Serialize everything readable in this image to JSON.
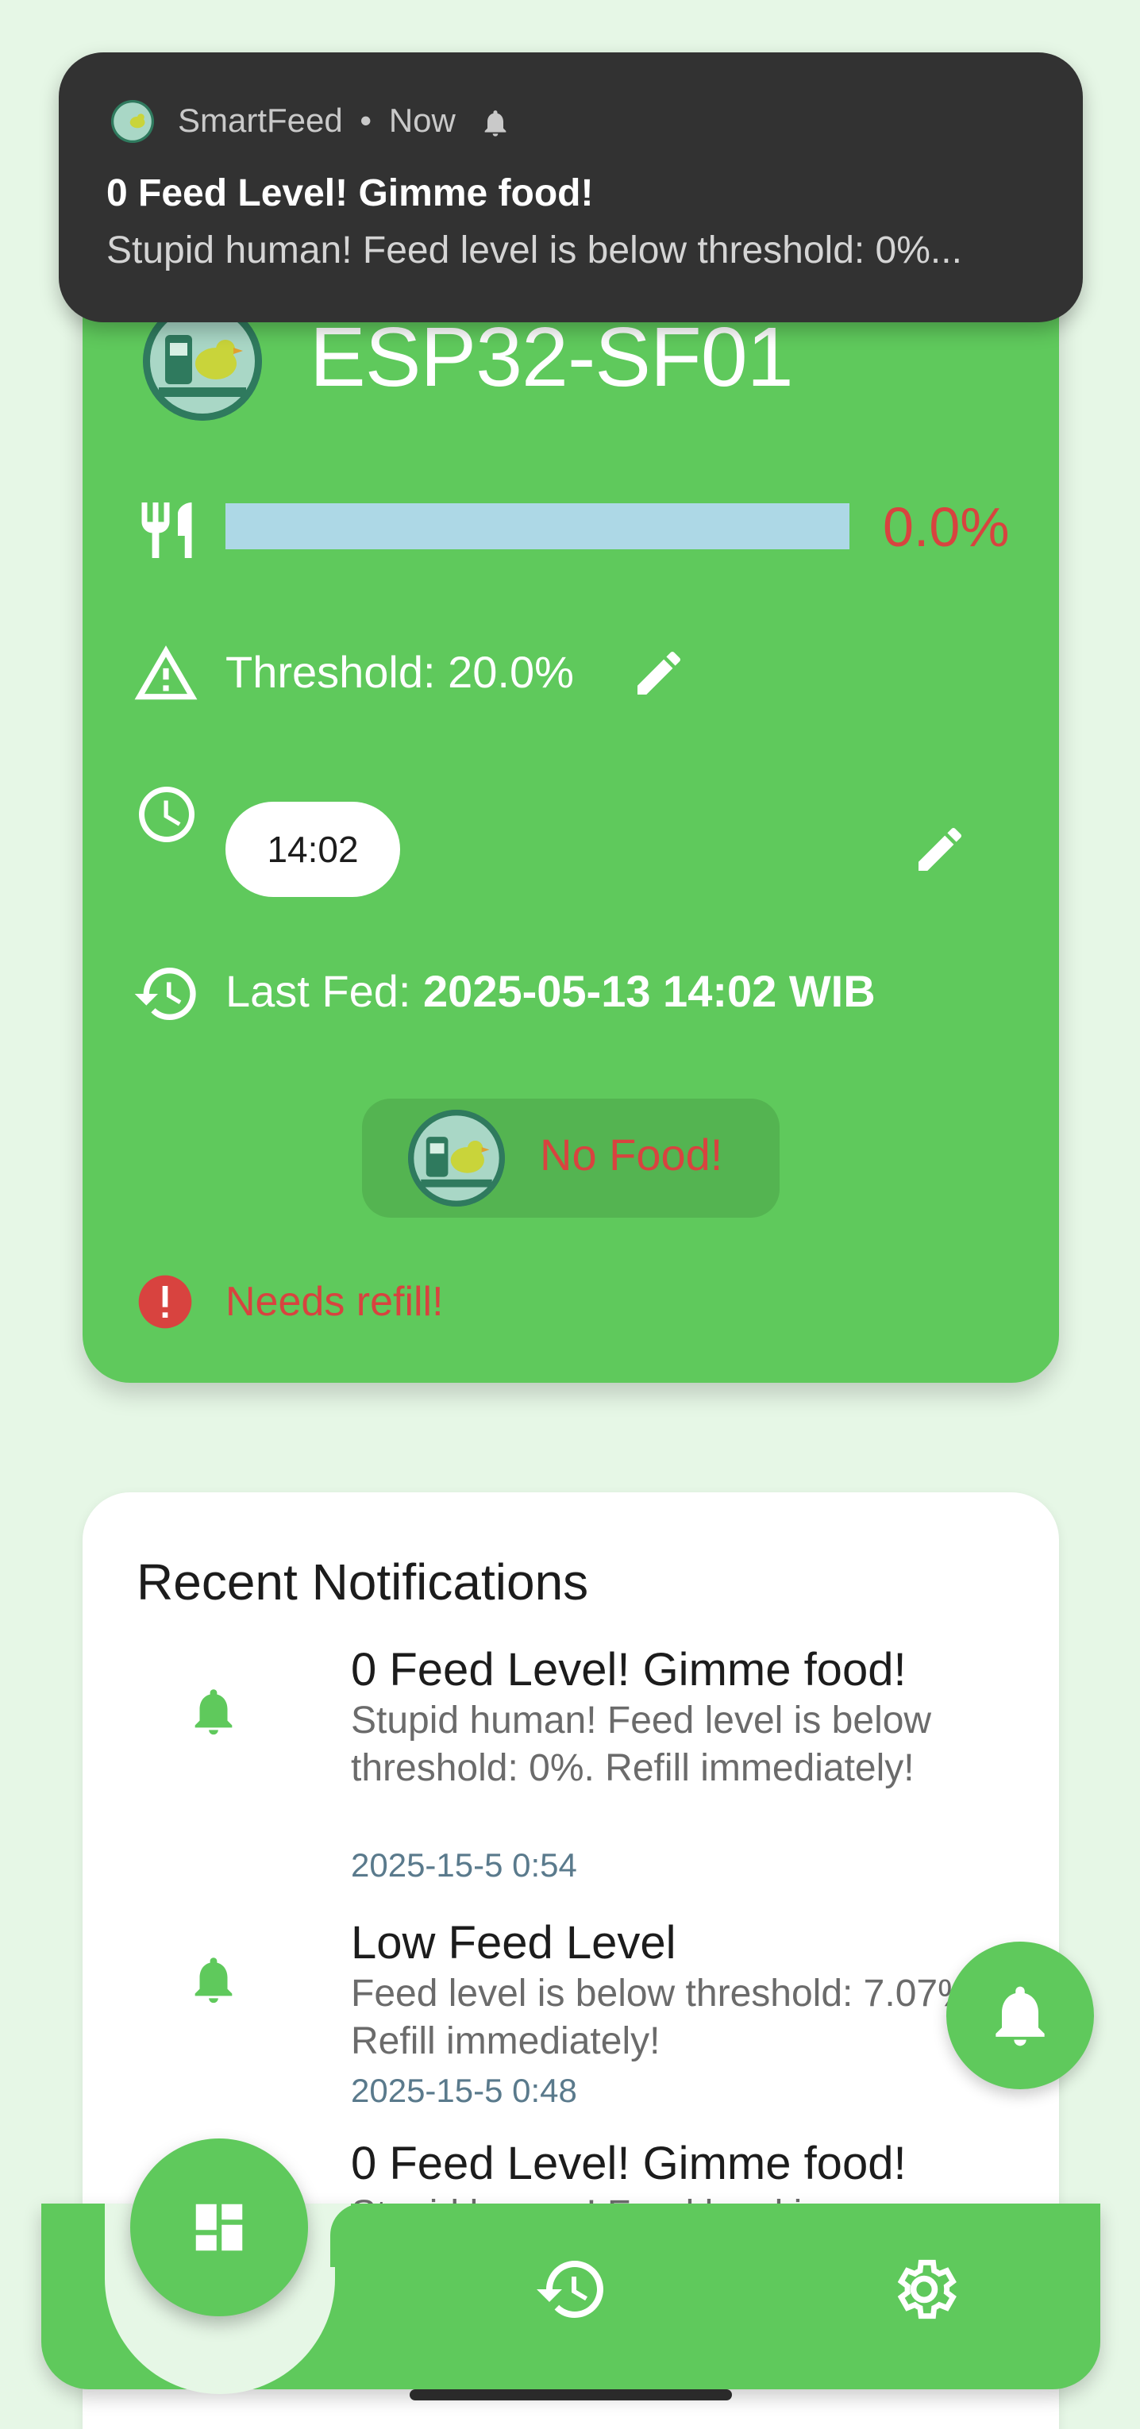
{
  "toast": {
    "app_name": "SmartFeed",
    "separator": "•",
    "time": "Now",
    "title": "0 Feed Level! Gimme food!",
    "body": "Stupid human! Feed level is below threshold: 0%..."
  },
  "device": {
    "name": "ESP32-SF01",
    "feed_level_fraction": 0.0,
    "feed_level_text": "0.0%",
    "threshold_label": "Threshold: 20.0%",
    "schedule_time": "14:02",
    "last_fed_label": "Last Fed: ",
    "last_fed_value": "2025-05-13 14:02 WIB",
    "status_button_label": "No Food!",
    "alert_text": "Needs refill!",
    "colors": {
      "card": "#5fc95c",
      "danger": "#d8433f",
      "bar": "#add8e6"
    }
  },
  "notifications": {
    "heading": "Recent Notifications",
    "items": [
      {
        "title": "0 Feed Level! Gimme food!",
        "body": "Stupid human! Feed level is below threshold: 0%. Refill immediately!",
        "time": "2025-15-5 0:54"
      },
      {
        "title": "Low Feed Level",
        "body": "Feed level is below threshold: 7.07%. Refill immediately!",
        "time": "2025-15-5 0:48"
      },
      {
        "title": "0 Feed Level! Gimme food!",
        "body": "Stupid human! Feed level is",
        "time": ""
      }
    ]
  },
  "nav": {
    "items": [
      "dashboard-icon",
      "history-icon",
      "settings-icon"
    ]
  }
}
